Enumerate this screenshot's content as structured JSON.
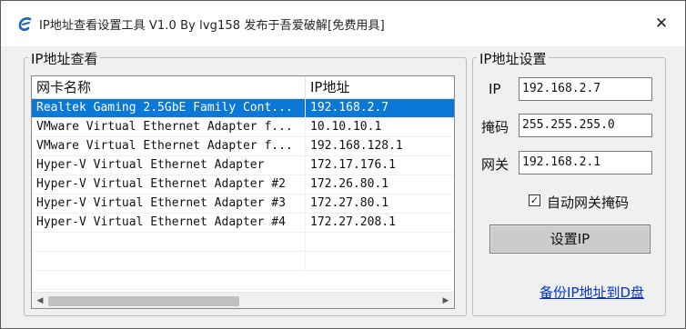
{
  "window": {
    "title": "IP地址查看设置工具 V1.0  By lvg158 发布于吾爱破解[免费用具]",
    "close_glyph": "✕"
  },
  "left_panel": {
    "title": "IP地址查看",
    "columns": [
      "网卡名称",
      "IP地址"
    ],
    "rows": [
      {
        "name": "Realtek Gaming 2.5GbE Family Cont...",
        "ip": "192.168.2.7",
        "selected": true
      },
      {
        "name": "VMware Virtual Ethernet Adapter f...",
        "ip": "10.10.10.1",
        "selected": false
      },
      {
        "name": "VMware Virtual Ethernet Adapter f...",
        "ip": "192.168.128.1",
        "selected": false
      },
      {
        "name": "Hyper-V Virtual Ethernet Adapter",
        "ip": "172.17.176.1",
        "selected": false
      },
      {
        "name": "Hyper-V Virtual Ethernet Adapter #2",
        "ip": "172.26.80.1",
        "selected": false
      },
      {
        "name": "Hyper-V Virtual Ethernet Adapter #3",
        "ip": "172.27.80.1",
        "selected": false
      },
      {
        "name": "Hyper-V Virtual Ethernet Adapter #4",
        "ip": "172.27.208.1",
        "selected": false
      }
    ]
  },
  "right_panel": {
    "title": "IP地址设置",
    "ip_label": "IP",
    "ip_value": "192.168.2.7",
    "mask_label": "掩码",
    "mask_value": "255.255.255.0",
    "gateway_label": "网关",
    "gateway_value": "192.168.2.1",
    "auto_mask_label": "自动网关掩码",
    "auto_mask_checked": true,
    "set_button": "设置IP",
    "backup_link": "备份IP地址到D盘"
  },
  "colors": {
    "selection": "#0a78d7",
    "link": "#0033cc"
  }
}
